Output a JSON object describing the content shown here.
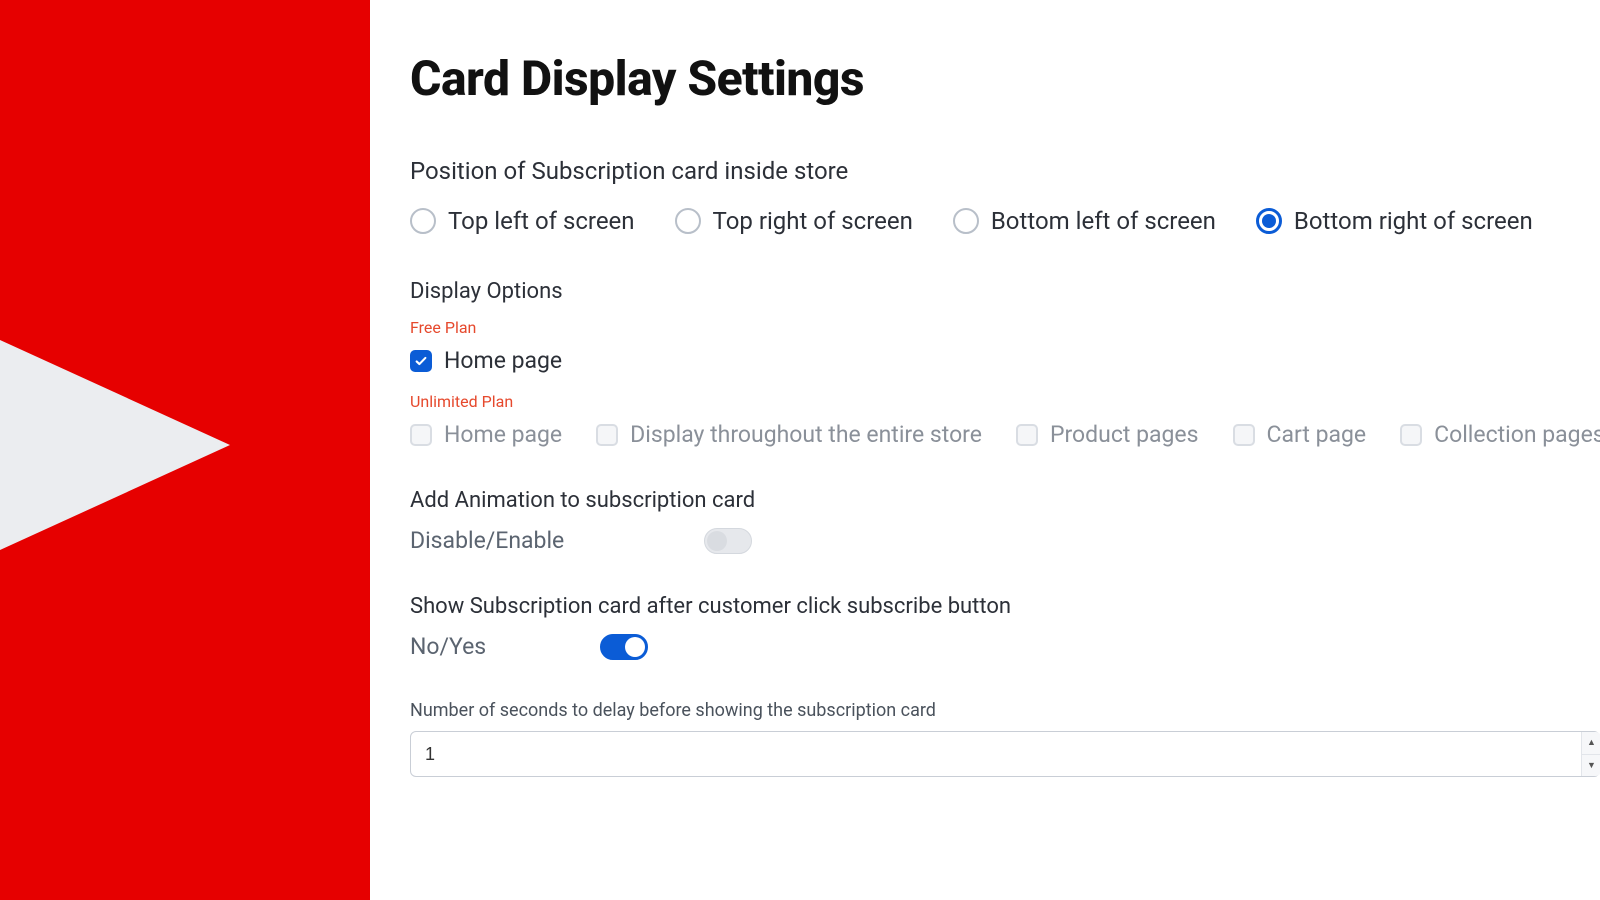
{
  "colors": {
    "accent_red": "#e60000",
    "accent_blue": "#0b5cd6",
    "plan_label": "#e6492d"
  },
  "page": {
    "title": "Card Display Settings"
  },
  "position": {
    "label": "Position of Subscription card inside store",
    "options": [
      {
        "label": "Top left of screen",
        "selected": false
      },
      {
        "label": "Top right of screen",
        "selected": false
      },
      {
        "label": "Bottom left of screen",
        "selected": false
      },
      {
        "label": "Bottom right of screen",
        "selected": true
      }
    ]
  },
  "display": {
    "label": "Display Options",
    "free_plan_label": "Free Plan",
    "free_options": [
      {
        "label": "Home page",
        "checked": true
      }
    ],
    "unlimited_plan_label": "Unlimited Plan",
    "unlimited_options": [
      {
        "label": "Home page",
        "checked": false
      },
      {
        "label": "Display throughout the entire store",
        "checked": false
      },
      {
        "label": "Product pages",
        "checked": false
      },
      {
        "label": "Cart page",
        "checked": false
      },
      {
        "label": "Collection pages",
        "checked": false
      }
    ]
  },
  "animation": {
    "label": "Add Animation to subscription card",
    "toggle_label": "Disable/Enable",
    "enabled": false
  },
  "show_after_subscribe": {
    "label": "Show Subscription card after customer click subscribe button",
    "toggle_label": "No/Yes",
    "enabled": true
  },
  "delay": {
    "label": "Number of seconds to delay before showing the subscription card",
    "value": "1"
  }
}
